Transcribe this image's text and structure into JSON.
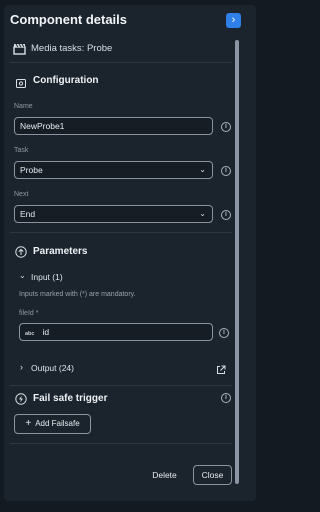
{
  "header": {
    "title": "Component details",
    "subtitle": "Media tasks: Probe"
  },
  "configuration": {
    "title": "Configuration",
    "name_label": "Name",
    "name_value": "NewProbe1",
    "task_label": "Task",
    "task_value": "Probe",
    "next_label": "Next",
    "next_value": "End"
  },
  "parameters": {
    "title": "Parameters",
    "input_label": "Input (1)",
    "mandatory_hint": "Inputs marked with (*) are mandatory.",
    "field_label": "fileId *",
    "field_type_badge": "abc",
    "field_value": "id",
    "output_label": "Output (24)"
  },
  "failsafe": {
    "title": "Fail safe trigger",
    "add_label": "Add Failsafe"
  },
  "footer": {
    "delete_label": "Delete",
    "close_label": "Close"
  },
  "colors": {
    "accent": "#2f7fe8",
    "panel_bg": "#1b232c",
    "page_bg": "#131a22"
  }
}
